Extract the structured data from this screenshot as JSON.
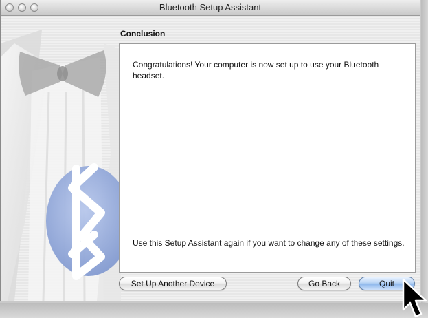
{
  "window": {
    "title": "Bluetooth Setup Assistant"
  },
  "content": {
    "section_title": "Conclusion",
    "message_top": "Congratulations! Your computer is now set up to use your Bluetooth headset.",
    "message_bottom": "Use this Setup Assistant again if you want to change any of these settings."
  },
  "buttons": {
    "set_up_another": "Set Up Another Device",
    "go_back": "Go Back",
    "quit": "Quit"
  },
  "icons": {
    "sidebar_art": "tuxedo-bluetooth-artwork",
    "cursor": "arrow-cursor-icon"
  },
  "colors": {
    "default_button": "#8fb8ec",
    "bluetooth_badge": "#8fa6d8"
  }
}
